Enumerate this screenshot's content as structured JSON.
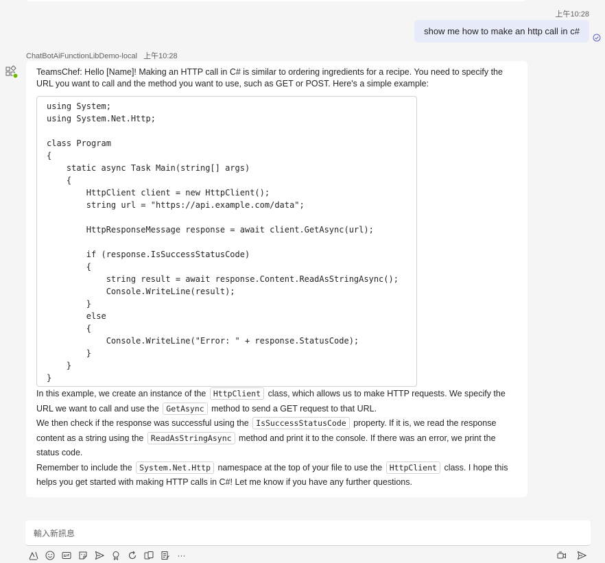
{
  "my_message": {
    "time": "上午10:28",
    "text": "show me how to make an http call in c#"
  },
  "bot": {
    "name": "ChatBotAiFunctionLibDemo-local",
    "time": "上午10:28",
    "intro": "TeamsChef: Hello [Name]! Making an HTTP call in C# is similar to ordering ingredients for a recipe. You need to specify the URL you want to call and the method you want to use, such as GET or POST. Here's a simple example:",
    "code": "using System;\nusing System.Net.Http;\n\nclass Program\n{\n    static async Task Main(string[] args)\n    {\n        HttpClient client = new HttpClient();\n        string url = \"https://api.example.com/data\";\n\n        HttpResponseMessage response = await client.GetAsync(url);\n\n        if (response.IsSuccessStatusCode)\n        {\n            string result = await response.Content.ReadAsStringAsync();\n            Console.WriteLine(result);\n        }\n        else\n        {\n            Console.WriteLine(\"Error: \" + response.StatusCode);\n        }\n    }\n}",
    "p1": {
      "a": "In this example, we create an instance of the",
      "c1": "HttpClient",
      "b": "class, which allows us to make HTTP requests. We specify the URL we want to call and use the",
      "c2": "GetAsync",
      "d": "method to send a GET request to that URL."
    },
    "p2": {
      "a": "We then check if the response was successful using the",
      "c1": "IsSuccessStatusCode",
      "b": "property. If it is, we read the response content as a string using the",
      "c2": "ReadAsStringAsync",
      "d": "method and print it to the console. If there was an error, we print the status code."
    },
    "p3": {
      "a": "Remember to include the",
      "c1": "System.Net.Http",
      "b": "namespace at the top of your file to use the",
      "c2": "HttpClient",
      "d": "class. I hope this helps you get started with making HTTP calls in C#! Let me know if you have any further questions."
    }
  },
  "compose": {
    "placeholder": "輸入新訊息"
  },
  "toolbar": {
    "icons": [
      "format-icon",
      "emoji-icon",
      "gif-icon",
      "sticker-icon",
      "schedule-icon",
      "praise-icon",
      "loop-icon",
      "attach-icon",
      "notes-icon",
      "more-icon"
    ],
    "more_label": "···"
  },
  "colors": {
    "my_bubble": "#e8ebfa",
    "background": "#f5f5f5",
    "accent": "#5b5fc7",
    "presence": "#6bb700"
  }
}
